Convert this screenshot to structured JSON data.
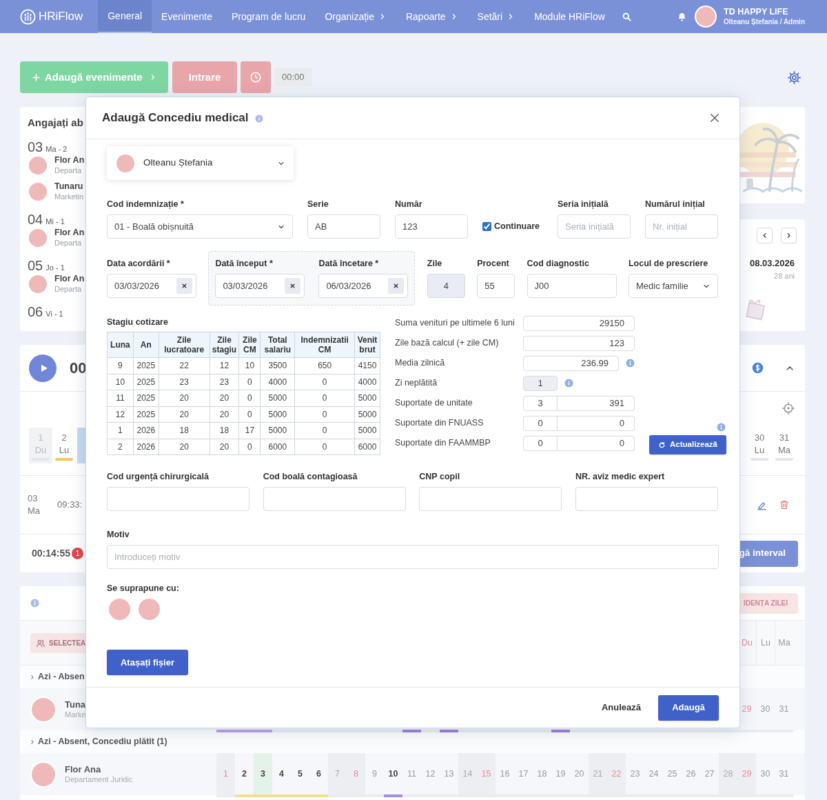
{
  "nav": {
    "logo": "HRiFlow",
    "items": [
      {
        "label": "General",
        "selected": true,
        "submenu": false
      },
      {
        "label": "Evenimente",
        "selected": false,
        "submenu": false
      },
      {
        "label": "Program de lucru",
        "selected": false,
        "submenu": false
      },
      {
        "label": "Organizație",
        "selected": false,
        "submenu": true
      },
      {
        "label": "Rapoarte",
        "selected": false,
        "submenu": true
      },
      {
        "label": "Setări",
        "selected": false,
        "submenu": true
      },
      {
        "label": "Module HRiFlow",
        "selected": false,
        "submenu": false
      }
    ],
    "company": "TD HAPPY LIFE",
    "user": "Olteanu Ștefania / Admin"
  },
  "toolbar": {
    "add_button": "Adaugă evenimente",
    "checkin_button": "Intrare",
    "timer": "00:00"
  },
  "absent_card": {
    "title": "Angajați ab",
    "days": [
      {
        "day": "03",
        "weekday": "Ma - 2",
        "people": [
          {
            "name": "Flor An",
            "department": "Departa"
          },
          {
            "name": "Tunaru",
            "department": "Marketin"
          }
        ]
      },
      {
        "day": "04",
        "weekday": "Mi - 1",
        "people": [
          {
            "name": "Flor An",
            "department": "Departa"
          }
        ]
      },
      {
        "day": "05",
        "weekday": "Jo - 1",
        "people": [
          {
            "name": "Flor An",
            "department": "Departa"
          }
        ]
      },
      {
        "day": "06",
        "weekday": "Vi - 1"
      }
    ]
  },
  "birthday_card": {
    "date": "08.03.2026",
    "age": "28 ani"
  },
  "timer_card": {
    "time": "00",
    "days_start": [
      {
        "number": "1",
        "weekday": "Du",
        "weekend": true,
        "color": "#e3e6ea"
      },
      {
        "number": "2",
        "weekday": "Lu",
        "weekend": false,
        "color": "#f2cd55"
      }
    ],
    "days_end": [
      {
        "number": "30",
        "weekday": "Lu",
        "weekend": false,
        "color": "#e3e6ea"
      },
      {
        "number": "31",
        "weekday": "Ma",
        "weekend": false,
        "color": "#e3e6ea"
      }
    ],
    "entry": {
      "date": "03",
      "weekday": "Ma",
      "time": "09:33:"
    },
    "elapsed": "00:14:55",
    "badge": "1",
    "interval_button": "gă interval"
  },
  "planner": {
    "highlight_button": "IDENȚA ZILEI",
    "select_button": "SELECTEA",
    "header_days": [
      {
        "weekday": "Du",
        "holiday": true
      },
      {
        "weekday": "Lu",
        "holiday": false
      },
      {
        "weekday": "Ma",
        "holiday": false
      }
    ],
    "groups": [
      {
        "title": "Azi - Absen",
        "employees": [
          {
            "name": "Tuna",
            "department": "Marke",
            "days": [
              {
                "absence": true,
                "color": "#b9a0e6"
              },
              {
                "absence": true,
                "color": "#b9a0e6"
              },
              {
                "absence": true,
                "color": "#b9a0e6"
              },
              {
                "absence": false
              },
              {
                "absence": false
              },
              {
                "absence": false
              },
              {
                "absence": false
              },
              {
                "absence": false
              },
              {
                "absence": false
              },
              {
                "absence": false
              },
              {
                "absence": true,
                "color": "#9b7fd9"
              },
              {
                "absence": false
              },
              {
                "absence": true,
                "color": "#9b7fd9"
              },
              {
                "absence": false
              },
              {
                "absence": false
              },
              {
                "absence": false
              },
              {
                "absence": false
              },
              {
                "absence": false
              },
              {
                "absence": true,
                "color": "#9b7fd9"
              },
              {
                "absence": false
              },
              {
                "absence": false
              },
              {
                "absence": false
              },
              {
                "absence": false
              },
              {
                "absence": false
              },
              {
                "absence": false
              },
              {
                "absence": false
              },
              {
                "absence": false
              },
              {
                "absence": false
              },
              {
                "absence": false,
                "number": "29",
                "holiday": true
              },
              {
                "absence": false,
                "number": "30",
                "holiday": false
              },
              {
                "absence": false,
                "number": "31",
                "holiday": false
              }
            ]
          }
        ]
      },
      {
        "title": "Azi - Absent, Concediu plătit (1)",
        "employees": [
          {
            "name": "Flor Ana",
            "department": "Departament Juridic",
            "days": [
              {
                "number": "1",
                "weekend": true,
                "holiday": true,
                "bold": false,
                "highlighted": false,
                "absence": false
              },
              {
                "number": "2",
                "weekend": false,
                "holiday": false,
                "bold": true,
                "highlighted": false,
                "absence": true,
                "color": "#f3df8a"
              },
              {
                "number": "3",
                "weekend": false,
                "holiday": false,
                "bold": true,
                "highlighted": true,
                "absence": true,
                "color": "#f3df8a"
              },
              {
                "number": "4",
                "weekend": false,
                "holiday": false,
                "bold": true,
                "highlighted": false,
                "absence": true,
                "color": "#f3df8a"
              },
              {
                "number": "5",
                "weekend": false,
                "holiday": false,
                "bold": true,
                "highlighted": false,
                "absence": true,
                "color": "#f3df8a"
              },
              {
                "number": "6",
                "weekend": false,
                "holiday": false,
                "bold": true,
                "highlighted": false,
                "absence": true,
                "color": "#f3df8a"
              },
              {
                "number": "7",
                "weekend": true,
                "holiday": false,
                "bold": false,
                "highlighted": false,
                "absence": false
              },
              {
                "number": "8",
                "weekend": true,
                "holiday": true,
                "bold": false,
                "highlighted": false,
                "absence": false
              },
              {
                "number": "9",
                "weekend": false,
                "holiday": false,
                "bold": false,
                "highlighted": false,
                "absence": false
              },
              {
                "number": "10",
                "weekend": false,
                "holiday": false,
                "bold": true,
                "highlighted": false,
                "absence": true,
                "color": "#a58ae6"
              },
              {
                "number": "11",
                "weekend": false,
                "holiday": false,
                "bold": false,
                "highlighted": false,
                "absence": false
              },
              {
                "number": "12",
                "weekend": false,
                "holiday": false,
                "bold": false,
                "highlighted": false,
                "absence": false
              },
              {
                "number": "13",
                "weekend": false,
                "holiday": false,
                "bold": false,
                "highlighted": false,
                "absence": false
              },
              {
                "number": "14",
                "weekend": true,
                "holiday": false,
                "bold": false,
                "highlighted": false,
                "absence": false
              },
              {
                "number": "15",
                "weekend": true,
                "holiday": true,
                "bold": false,
                "highlighted": false,
                "absence": false
              },
              {
                "number": "16",
                "weekend": false,
                "holiday": false,
                "bold": false,
                "highlighted": false,
                "absence": false
              },
              {
                "number": "17",
                "weekend": false,
                "holiday": false,
                "bold": false,
                "highlighted": false,
                "absence": false
              },
              {
                "number": "18",
                "weekend": false,
                "holiday": false,
                "bold": false,
                "highlighted": false,
                "absence": false
              },
              {
                "number": "19",
                "weekend": false,
                "holiday": false,
                "bold": false,
                "highlighted": false,
                "absence": false
              },
              {
                "number": "20",
                "weekend": false,
                "holiday": false,
                "bold": false,
                "highlighted": false,
                "absence": false
              },
              {
                "number": "21",
                "weekend": true,
                "holiday": false,
                "bold": false,
                "highlighted": false,
                "absence": false
              },
              {
                "number": "22",
                "weekend": true,
                "holiday": true,
                "bold": false,
                "highlighted": false,
                "absence": false
              },
              {
                "number": "23",
                "weekend": false,
                "holiday": false,
                "bold": false,
                "highlighted": false,
                "absence": false
              },
              {
                "number": "24",
                "weekend": false,
                "holiday": false,
                "bold": false,
                "highlighted": false,
                "absence": false
              },
              {
                "number": "25",
                "weekend": false,
                "holiday": false,
                "bold": false,
                "highlighted": false,
                "absence": false
              },
              {
                "number": "26",
                "weekend": false,
                "holiday": false,
                "bold": false,
                "highlighted": false,
                "absence": false
              },
              {
                "number": "27",
                "weekend": false,
                "holiday": false,
                "bold": false,
                "highlighted": false,
                "absence": false
              },
              {
                "number": "28",
                "weekend": true,
                "holiday": false,
                "bold": false,
                "highlighted": false,
                "absence": false
              },
              {
                "number": "29",
                "weekend": true,
                "holiday": true,
                "bold": false,
                "highlighted": false,
                "absence": false
              },
              {
                "number": "30",
                "weekend": false,
                "holiday": false,
                "bold": false,
                "highlighted": false,
                "absence": false
              },
              {
                "number": "31",
                "weekend": false,
                "holiday": false,
                "bold": false,
                "highlighted": false,
                "absence": false
              }
            ]
          }
        ]
      }
    ]
  },
  "modal": {
    "title": "Adaugă Concediu medical",
    "employee": "Olteanu Ștefania",
    "row1": [
      {
        "kind": "select",
        "label": "Cod indemnizație *",
        "value": "01 - Boală obișnuită"
      },
      {
        "kind": "text",
        "label": "Serie",
        "value": "AB"
      },
      {
        "kind": "text",
        "label": "Număr",
        "value": "123"
      },
      {
        "kind": "checkbox",
        "label": "Continuare",
        "checked": true
      },
      {
        "kind": "text",
        "label": "Seria inițială",
        "placeholder": "Seria inițială"
      },
      {
        "kind": "text",
        "label": "Numărul inițial",
        "placeholder": "Nr. inițial"
      }
    ],
    "row2": [
      {
        "kind": "date",
        "label": "Data acordării *",
        "value": "03/03/2026"
      },
      {
        "kind": "range",
        "fields": [
          {
            "label": "Dată început *",
            "value": "03/03/2026"
          },
          {
            "label": "Dată încetare *",
            "value": "06/03/2026"
          }
        ]
      },
      {
        "kind": "readonly",
        "label": "Zile",
        "value": "4"
      },
      {
        "kind": "text",
        "label": "Procent",
        "value": "55"
      },
      {
        "kind": "text",
        "label": "Cod diagnostic",
        "value": "J00"
      },
      {
        "kind": "select",
        "label": "Locul de prescriere",
        "value": "Medic familie"
      }
    ],
    "contribution": {
      "title": "Stagiu cotizare",
      "columns": [
        "Luna",
        "An",
        "Zile lucratoare",
        "Zile stagiu",
        "Zile CM",
        "Total salariu",
        "Indemnizatii CM",
        "Venit brut"
      ],
      "rows": [
        [
          "9",
          "2025",
          "22",
          "12",
          "10",
          "3500",
          "650",
          "4150"
        ],
        [
          "10",
          "2025",
          "23",
          "23",
          "0",
          "4000",
          "0",
          "4000"
        ],
        [
          "11",
          "2025",
          "20",
          "20",
          "0",
          "5000",
          "0",
          "5000"
        ],
        [
          "12",
          "2025",
          "20",
          "20",
          "0",
          "5000",
          "0",
          "5000"
        ],
        [
          "1",
          "2026",
          "18",
          "18",
          "17",
          "5000",
          "0",
          "5000"
        ],
        [
          "2",
          "2026",
          "20",
          "20",
          "0",
          "6000",
          "0",
          "6000"
        ]
      ]
    },
    "calculation": [
      {
        "kind": "wide",
        "label": "Suma venituri pe ultimele 6 luni",
        "values": [
          "29150"
        ]
      },
      {
        "kind": "wide",
        "label": "Zile bază calcul (+ zile CM)",
        "values": [
          "123"
        ]
      },
      {
        "kind": "info",
        "label": "Media zilnică",
        "values": [
          "236.99"
        ]
      },
      {
        "kind": "small",
        "label": "Zi neplătită",
        "values": [
          "1"
        ]
      },
      {
        "kind": "split",
        "label": "Suportate de unitate",
        "values": [
          "3",
          "391"
        ]
      },
      {
        "kind": "split",
        "label": "Suportate din FNUASS",
        "values": [
          "0",
          "0"
        ]
      },
      {
        "kind": "split",
        "label": "Suportate din FAAMMBP",
        "values": [
          "0",
          "0"
        ]
      }
    ],
    "update_button": "Actualizează",
    "row3": [
      {
        "label": "Cod urgență chirurgicală"
      },
      {
        "label": "Cod boală contagioasă"
      },
      {
        "label": "CNP copil"
      },
      {
        "label": "NR. aviz medic expert"
      }
    ],
    "reason": {
      "label": "Motiv",
      "placeholder": "Introduceți motiv"
    },
    "overlap": {
      "label": "Se suprapune cu:",
      "avatars": [
        {
          "kind": "photo"
        },
        {
          "kind": "photo"
        }
      ]
    },
    "attach_button": "Atașați fișier",
    "cancel_button": "Anulează",
    "submit_button": "Adaugă"
  }
}
